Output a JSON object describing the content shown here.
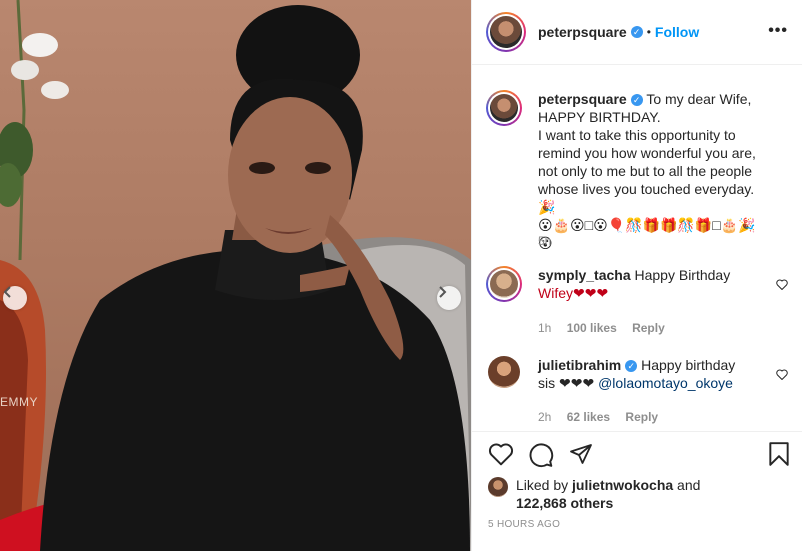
{
  "post": {
    "watermark": "EMMY",
    "author": {
      "username": "peterpsquare",
      "verified_icon": "verified-badge-icon",
      "follow_label": "Follow",
      "separator": "•"
    },
    "more_icon": "more-options-icon",
    "caption": {
      "username": "peterpsquare",
      "line1": "To my dear Wife,",
      "line2": "HAPPY BIRTHDAY.",
      "line3": "I want to take this opportunity to",
      "line4": "remind you how wonderful you are,",
      "line5": "not only to me but to all the people",
      "line6": "whose lives you touched everyday. 🎉",
      "emojis": "😮🎂😮□😮🎈🎊🎁🎁🎊🎁□🎂🎉😮",
      "time": "5h"
    },
    "comments": [
      {
        "username": "symply_tacha",
        "text": "Happy Birthday",
        "text2": "Wifey❤❤❤",
        "time": "1h",
        "likes": "100 likes",
        "reply": "Reply"
      },
      {
        "username": "julietibrahim",
        "text": "Happy birthday",
        "text2_prefix": "sis ❤❤❤ ",
        "mention": "@lolaomotayo_okoye",
        "time": "2h",
        "likes": "62 likes",
        "reply": "Reply"
      }
    ],
    "likes_summary": {
      "prefix": "Liked by ",
      "liker": "julietnwokocha",
      "middle": " and",
      "count": "122,868 others"
    },
    "posted_ago": "5 HOURS AGO"
  },
  "colors": {
    "link_blue": "#0095f6",
    "verified_blue": "#3897f0",
    "muted": "#8e8e8e",
    "heart_red": "#ed4956"
  }
}
